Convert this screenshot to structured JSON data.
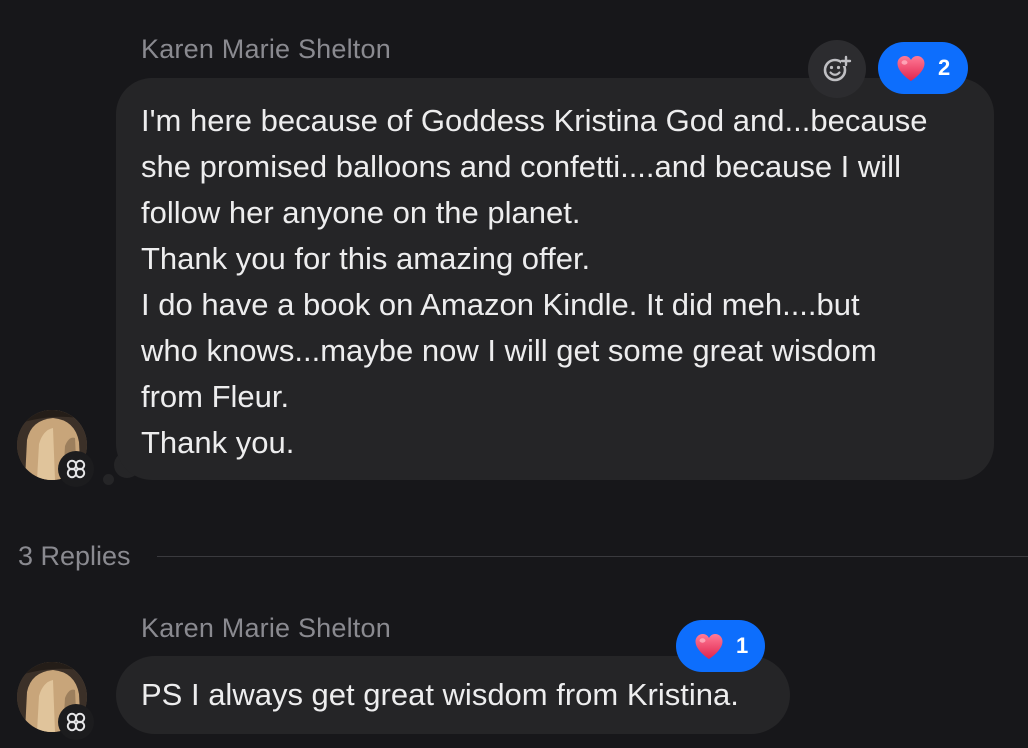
{
  "comment": {
    "author": "Karen Marie Shelton",
    "text": "I'm here because of Goddess Kristina God and...because\nshe promised balloons and confetti....and because I will\nfollow her anyone on the planet.\nThank you for this amazing offer.\nI do have a book on Amazon Kindle. It did meh....but\nwho knows...maybe now I will get some great wisdom\nfrom Fleur.\nThank you.",
    "reaction": {
      "icon": "heart-icon",
      "count": "2"
    },
    "add_reaction_icon": "add-emoji-icon"
  },
  "replies": {
    "label": "3 Replies"
  },
  "reply": {
    "author": "Karen Marie Shelton",
    "text": "PS I always get great wisdom from Kristina.",
    "reaction": {
      "icon": "heart-icon",
      "count": "1"
    }
  },
  "colors": {
    "background": "#17171a",
    "bubble": "#252527",
    "reaction_accent": "#0d6efd",
    "heart": "#f0476a",
    "muted_text": "#8a8a90"
  }
}
